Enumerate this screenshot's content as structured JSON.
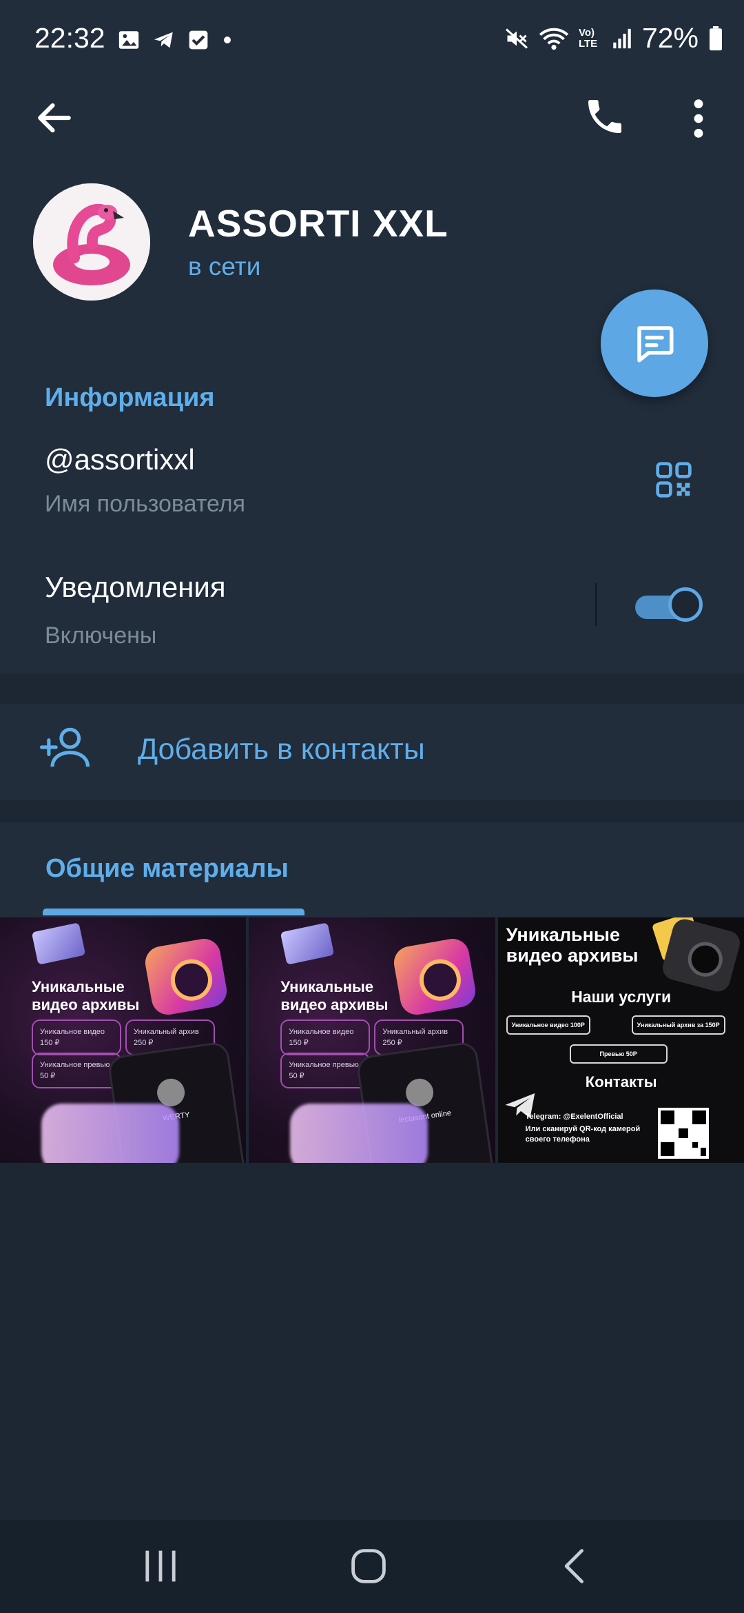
{
  "status_bar": {
    "time": "22:32",
    "left_icons": [
      "image-icon",
      "telegram-icon",
      "checkbox-icon",
      "dot-icon"
    ],
    "right_icons": [
      "mute-icon",
      "wifi-icon",
      "volte-icon",
      "signal-icon",
      "battery-icon"
    ],
    "volte_label": "Vo) LTE",
    "battery": "72%"
  },
  "header": {
    "back_icon": "arrow-left-icon",
    "call_icon": "phone-icon",
    "more_icon": "more-vertical-icon"
  },
  "profile": {
    "name": "ASSORTI XXL",
    "status": "в сети",
    "avatar": "flamingo-float-avatar"
  },
  "fab": {
    "icon": "message-icon"
  },
  "info": {
    "title": "Информация",
    "username": "@assortixxl",
    "username_label": "Имя пользователя",
    "qr_icon": "qr-code-icon",
    "notifications_title": "Уведомления",
    "notifications_status": "Включены",
    "notifications_on": true
  },
  "add_contact": {
    "icon": "add-person-icon",
    "label": "Добавить в контакты"
  },
  "shared_media": {
    "tab_label": "Общие материалы",
    "items": [
      {
        "title": "Уникальные видео архивы",
        "pills": [
          {
            "name": "Уникальное видео",
            "price": "150 ₽"
          },
          {
            "name": "Уникальный архив",
            "price": "250 ₽"
          },
          {
            "name": "Уникальное превью",
            "price": "50 ₽"
          }
        ],
        "phone_name": "WERTY"
      },
      {
        "title": "Уникальные видео архивы",
        "pills": [
          {
            "name": "Уникальное видео",
            "price": "150 ₽"
          },
          {
            "name": "Уникальный архив",
            "price": "250 ₽"
          },
          {
            "name": "Уникальное превью",
            "price": "50 ₽"
          }
        ],
        "phone_name": "lectasant online"
      },
      {
        "title": "Уникальные видео архивы",
        "services_title": "Наши услуги",
        "services": [
          "Уникальное видео 100Р",
          "Уникальный архив за 150Р",
          "Превью 50Р"
        ],
        "contacts_title": "Контакты",
        "telegram": "Telegram: @ExelentOfficial",
        "qr_text": "Или сканируй QR-код камерой своего телефона"
      }
    ]
  },
  "nav_bar": {
    "icons": [
      "recent-apps-icon",
      "home-icon",
      "back-icon"
    ]
  },
  "colors": {
    "background": "#1d2733",
    "panel": "#212d3b",
    "accent": "#5faeea",
    "fab": "#5da7e4",
    "muted_text": "#7d8b99"
  }
}
